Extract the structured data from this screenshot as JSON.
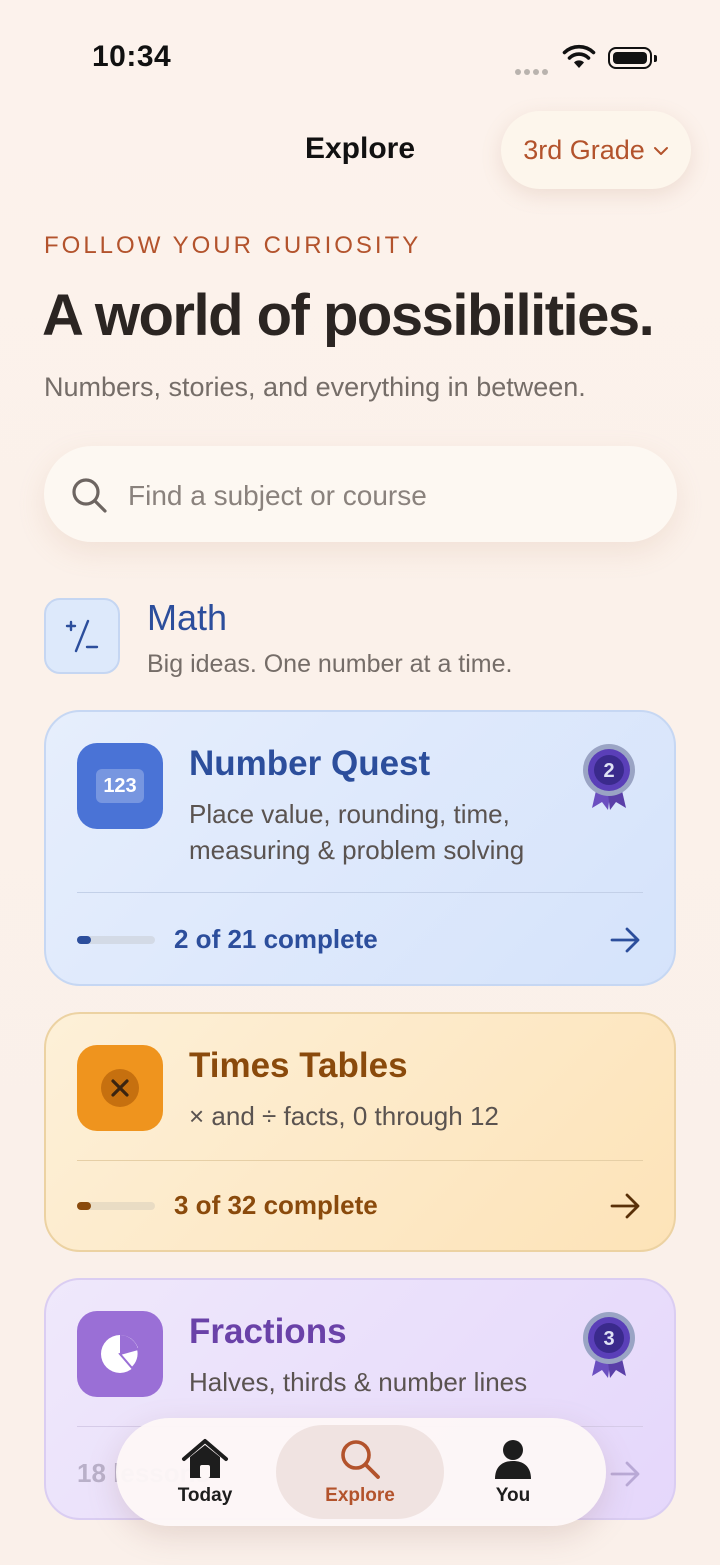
{
  "status_bar": {
    "time": "10:34"
  },
  "nav": {
    "title": "Explore",
    "grade_label": "3rd Grade"
  },
  "hero": {
    "eyebrow": "FOLLOW YOUR CURIOSITY",
    "headline": "A world of possibilities.",
    "subheadline": "Numbers, stories, and everything in between."
  },
  "search": {
    "placeholder": "Find a subject or course"
  },
  "subject": {
    "title": "Math",
    "subtitle": "Big ideas. One number at a time."
  },
  "courses": [
    {
      "title": "Number Quest",
      "description_line1": "Place value, rounding, time,",
      "description_line2": "measuring & problem solving",
      "icon_text": "123",
      "progress_text": "2 of 21 complete",
      "progress_fraction": 0.095,
      "badge_number": "2",
      "accent": "#2c4e9c"
    },
    {
      "title": "Times Tables",
      "description_line1": "× and ÷ facts, 0 through 12",
      "progress_text": "3 of 32 complete",
      "progress_fraction": 0.094,
      "accent": "#8a4a0c"
    },
    {
      "title": "Fractions",
      "description_line1": "Halves, thirds & number lines",
      "progress_text": "18 lessons",
      "badge_number": "3",
      "accent": "#6a42a8"
    }
  ],
  "tab_bar": {
    "items": [
      {
        "label": "Today"
      },
      {
        "label": "Explore"
      },
      {
        "label": "You"
      }
    ]
  }
}
